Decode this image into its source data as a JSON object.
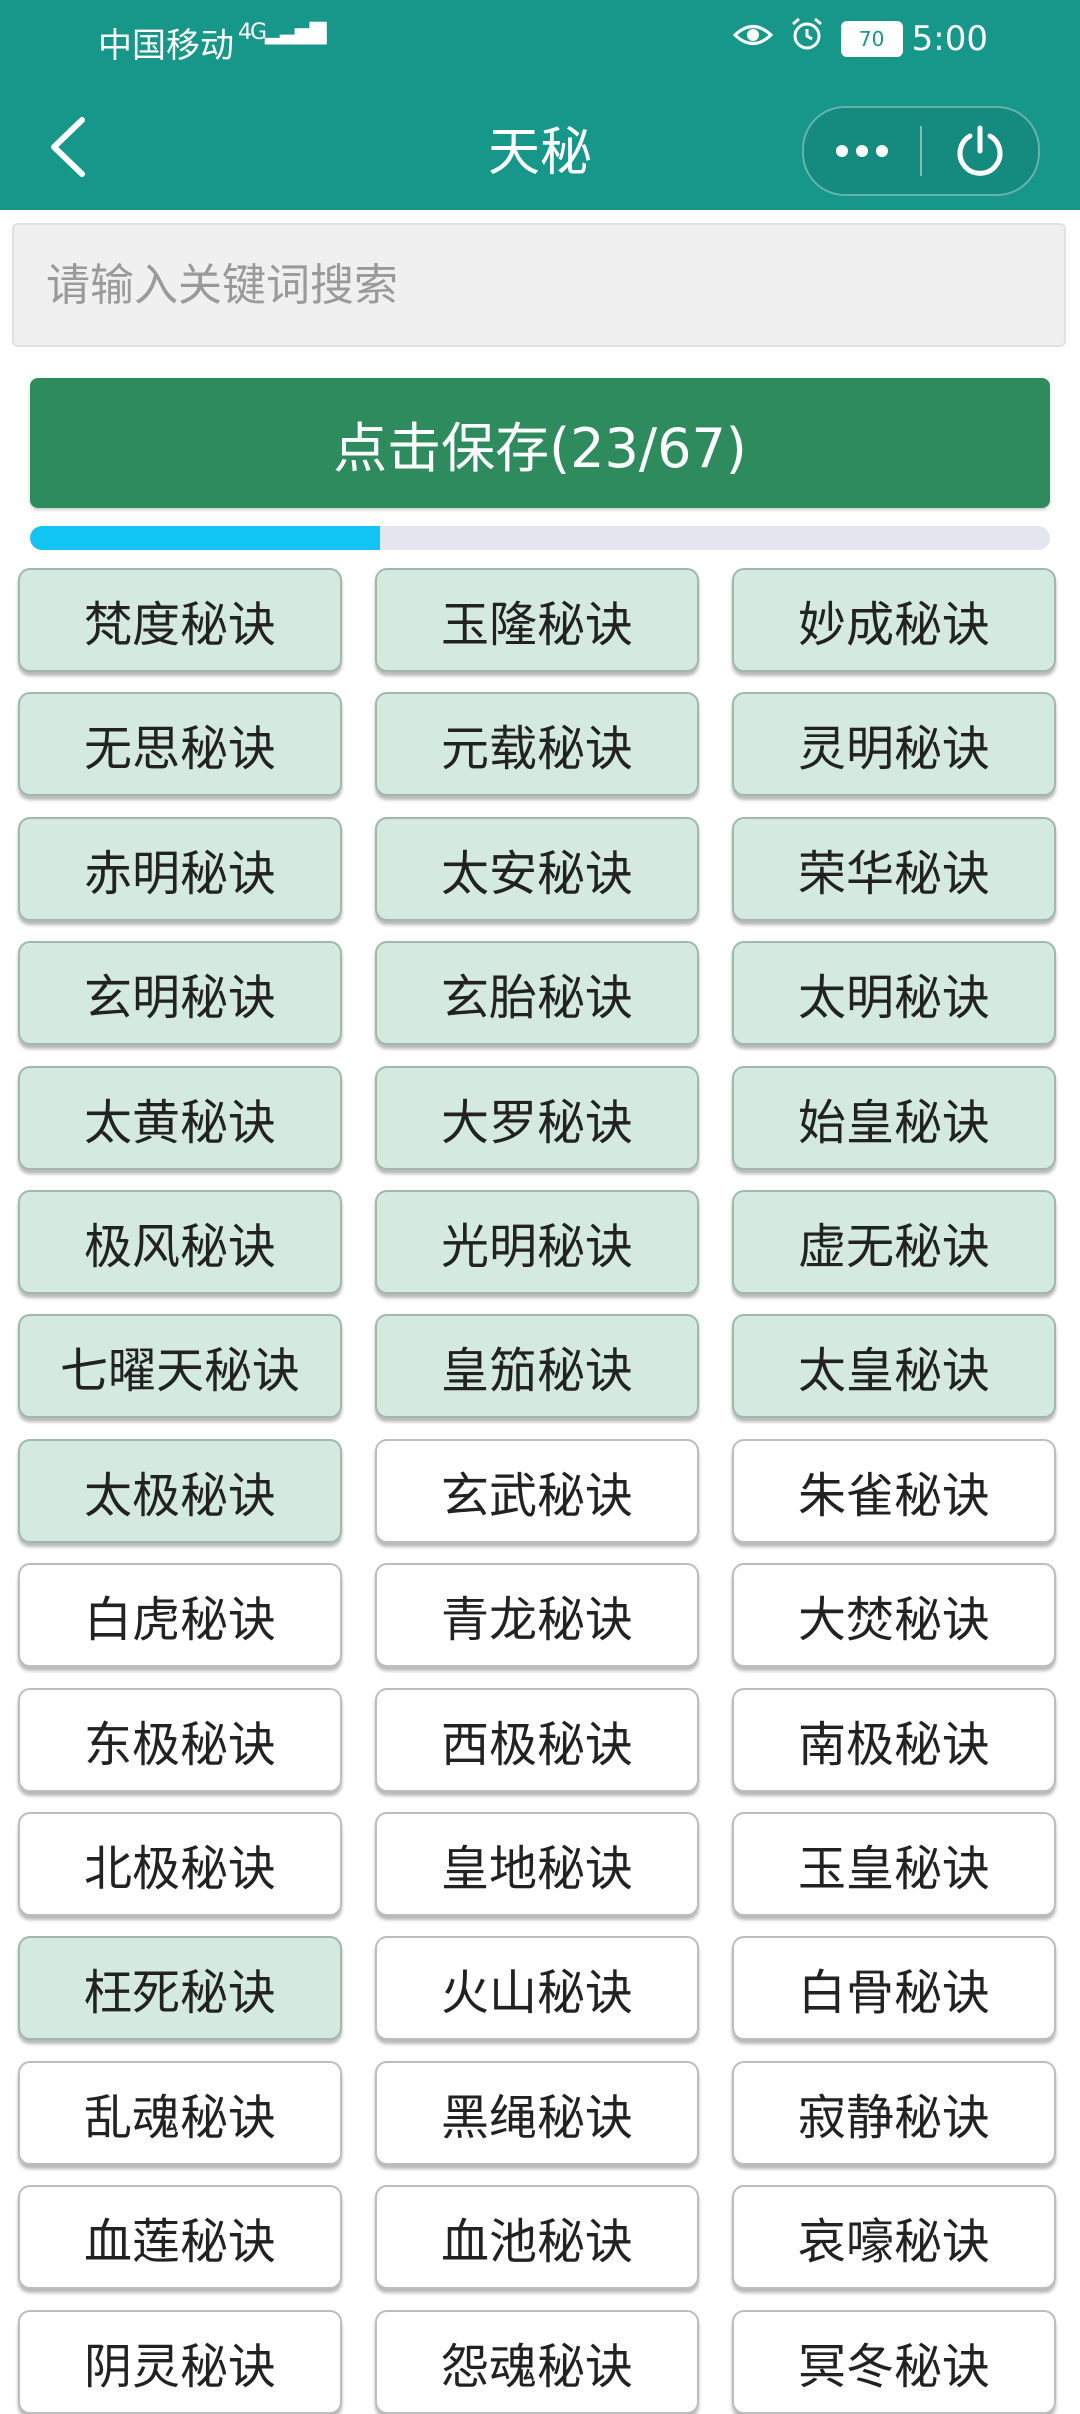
{
  "status_bar": {
    "carrier": "中国移动",
    "network": "4G",
    "battery": "70",
    "time": "5:00"
  },
  "header": {
    "title": "天秘"
  },
  "search": {
    "placeholder": "请输入关键词搜索",
    "value": ""
  },
  "save_button": {
    "label": "点击保存(23/67)"
  },
  "progress": {
    "current": 23,
    "total": 67,
    "fraction": 0.343
  },
  "colors": {
    "header": "#17968a",
    "save_button": "#2e8b5e",
    "progress_fill": "#11c4f3",
    "selected_item": "#d4e9e0"
  },
  "items": [
    {
      "label": "梵度秘诀",
      "selected": true
    },
    {
      "label": "玉隆秘诀",
      "selected": true
    },
    {
      "label": "妙成秘诀",
      "selected": true
    },
    {
      "label": "无思秘诀",
      "selected": true
    },
    {
      "label": "元载秘诀",
      "selected": true
    },
    {
      "label": "灵明秘诀",
      "selected": true
    },
    {
      "label": "赤明秘诀",
      "selected": true
    },
    {
      "label": "太安秘诀",
      "selected": true
    },
    {
      "label": "荣华秘诀",
      "selected": true
    },
    {
      "label": "玄明秘诀",
      "selected": true
    },
    {
      "label": "玄胎秘诀",
      "selected": true
    },
    {
      "label": "太明秘诀",
      "selected": true
    },
    {
      "label": "太黄秘诀",
      "selected": true
    },
    {
      "label": "大罗秘诀",
      "selected": true
    },
    {
      "label": "始皇秘诀",
      "selected": true
    },
    {
      "label": "极风秘诀",
      "selected": true
    },
    {
      "label": "光明秘诀",
      "selected": true
    },
    {
      "label": "虚无秘诀",
      "selected": true
    },
    {
      "label": "七曜天秘诀",
      "selected": true
    },
    {
      "label": "皇笳秘诀",
      "selected": true
    },
    {
      "label": "太皇秘诀",
      "selected": true
    },
    {
      "label": "太极秘诀",
      "selected": true
    },
    {
      "label": "玄武秘诀",
      "selected": false
    },
    {
      "label": "朱雀秘诀",
      "selected": false
    },
    {
      "label": "白虎秘诀",
      "selected": false
    },
    {
      "label": "青龙秘诀",
      "selected": false
    },
    {
      "label": "大焚秘诀",
      "selected": false
    },
    {
      "label": "东极秘诀",
      "selected": false
    },
    {
      "label": "西极秘诀",
      "selected": false
    },
    {
      "label": "南极秘诀",
      "selected": false
    },
    {
      "label": "北极秘诀",
      "selected": false
    },
    {
      "label": "皇地秘诀",
      "selected": false
    },
    {
      "label": "玉皇秘诀",
      "selected": false
    },
    {
      "label": "枉死秘诀",
      "selected": true
    },
    {
      "label": "火山秘诀",
      "selected": false
    },
    {
      "label": "白骨秘诀",
      "selected": false
    },
    {
      "label": "乱魂秘诀",
      "selected": false
    },
    {
      "label": "黑绳秘诀",
      "selected": false
    },
    {
      "label": "寂静秘诀",
      "selected": false
    },
    {
      "label": "血莲秘诀",
      "selected": false
    },
    {
      "label": "血池秘诀",
      "selected": false
    },
    {
      "label": "哀嚎秘诀",
      "selected": false
    },
    {
      "label": "阴灵秘诀",
      "selected": false
    },
    {
      "label": "怨魂秘诀",
      "selected": false
    },
    {
      "label": "冥冬秘诀",
      "selected": false
    }
  ]
}
